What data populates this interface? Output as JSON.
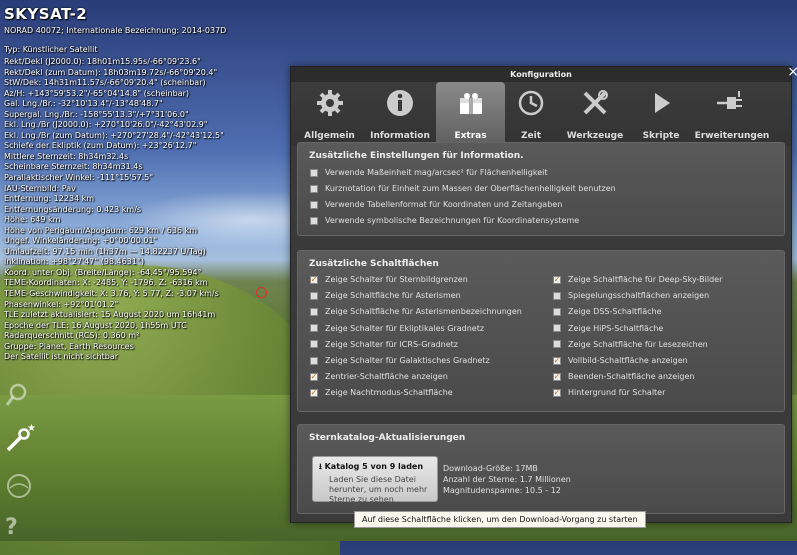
{
  "object": {
    "name": "SKYSAT-2",
    "norad": "NORAD 40072; Internationale Bezeichnung: 2014-037D",
    "type_line": "Typ: Künstlicher Satellit",
    "lines": [
      "Rekt/Dekl (J2000.0): 18h01m15.95s/-66°09'23.6\"",
      "Rekt/Dekl (zum Datum): 18h03m19.72s/-66°09'20.4\"",
      "StW/Dek: 14h31m11.57s/-66°09'20.4\" (scheinbar)",
      "Az/H: +143°59'53.2\"/-65°04'14.8\" (scheinbar)",
      "Gal. Lng./Br.: -32°10'13.4\"/-13°48'48.7\"",
      "Supergal. Lng./Br.: -158°55'13.3\"/+7°31'06.0\"",
      "Ekl. Lng./Br (J2000.0): +270°10'26.0\"/-42°43'02.9\"",
      "Ekl. Lng./Br (zum Datum): +270°27'28.4\"/-42°43'12.5\"",
      "Schiefe der Ekliptik (zum Datum): +23°26'12.7\"",
      "Mittlere Sternzeit: 8h34m32.4s",
      "Scheinbare Sternzeit: 8h34m31.4s",
      "Parallaktischer Winkel: -111°15'57.5\"",
      "IAU-Sternbild: Pav",
      "Entfernung: 12234 km",
      "Entfernungsänderung: 0.423 km/s",
      "Höhe: 649 km",
      "Höhe von Perigäum/Apogäum: 629 km / 636 km",
      "Ungef. Winkeländerung: +0°00'00.01\"",
      "Umlaufzeit: 97.15 min (1h37m — 14.82237 U/Tag)",
      "Inklination: +98°27'47\" (98.4631°)",
      "Koord. unter Obj. (Breite/Länge): -64.45°/95.594°",
      "TEME-Koordinaten: X: -2485, Y: -1796, Z: -6316 km",
      "TEME-Geschwindigkeit: X: 3.76, Y: 5.77, Z: -3.07 km/s",
      "Phasenwinkel: +92°01'01.2\"",
      "TLE zuletzt aktualisiert: 15 August 2020 um 16h41m",
      "Epoche der TLE: 16 August 2020, 1h55m UTC",
      "Radarquerschnitt (RCS): 0.360 m²",
      "Gruppe: Planet, Earth Resources",
      "Der Satellit ist nicht sichtbar"
    ]
  },
  "dialog": {
    "title": "Konfiguration",
    "close": "×",
    "tabs": [
      {
        "label": "Allgemein",
        "icon": "gear-icon"
      },
      {
        "label": "Information",
        "icon": "info-icon"
      },
      {
        "label": "Extras",
        "icon": "extras-icon",
        "active": true
      },
      {
        "label": "Zeit",
        "icon": "clock-icon"
      },
      {
        "label": "Werkzeuge",
        "icon": "tools-icon"
      },
      {
        "label": "Skripte",
        "icon": "play-icon"
      },
      {
        "label": "Erweiterungen",
        "icon": "plugin-icon"
      }
    ],
    "info_group": {
      "title": "Zusätzliche Einstellungen für Information.",
      "options": [
        {
          "label": "Verwende Maßeinheit mag/arcsec² für Flächenhelligkeit",
          "checked": false
        },
        {
          "label": "Kurznotation für Einheit zum Massen der Oberflächenhelligkeit benutzen",
          "checked": false
        },
        {
          "label": "Verwende Tabellenformat für Koordinaten und Zeitangaben",
          "checked": false
        },
        {
          "label": "Verwende symbolische Bezeichnungen für Koordinatensysteme",
          "checked": false
        }
      ]
    },
    "buttons_group": {
      "title": "Zusätzliche Schaltflächen",
      "left": [
        {
          "label": "Zeige Schalter für Sternbildgrenzen",
          "checked": true
        },
        {
          "label": "Zeige Schaltfläche für Asterismen",
          "checked": false
        },
        {
          "label": "Zeige Schaltfläche für Asterismenbezeichnungen",
          "checked": false
        },
        {
          "label": "Zeige Schalter für Ekliptikales Gradnetz",
          "checked": false
        },
        {
          "label": "Zeige Schalter für ICRS-Gradnetz",
          "checked": false
        },
        {
          "label": "Zeige Schalter für Galaktisches Gradnetz",
          "checked": false
        },
        {
          "label": "Zentrier-Schaltfläche anzeigen",
          "checked": true
        },
        {
          "label": "Zeige Nachtmodus-Schaltfläche",
          "checked": true
        }
      ],
      "right": [
        {
          "label": "Zeige Schaltfläche für Deep-Sky-Bilder",
          "checked": true
        },
        {
          "label": "Spiegelungsschaltflächen anzeigen",
          "checked": false
        },
        {
          "label": "Zeige DSS-Schaltfläche",
          "checked": false
        },
        {
          "label": "Zeige HiPS-Schaltfläche",
          "checked": false
        },
        {
          "label": "Zeige Schaltfläche für Lesezeichen",
          "checked": false
        },
        {
          "label": "Vollbild-Schaltfläche anzeigen",
          "checked": true
        },
        {
          "label": "Beenden-Schaltfläche anzeigen",
          "checked": true
        },
        {
          "label": "Hintergrund für Schalter",
          "checked": true
        }
      ]
    },
    "catalog_group": {
      "title": "Sternkatalog-Aktualisierungen",
      "button_title": "Katalog 5 von 9 laden",
      "button_desc": [
        "Laden Sie diese Datei",
        "herunter, um noch mehr",
        "Sterne zu sehen"
      ],
      "stats": [
        "Download-Größe: 17MB",
        "Anzahl der Sterne: 1.7 Millionen",
        "Magnitudenspanne: 10.5 - 12"
      ]
    }
  },
  "tooltip": "Auf diese Schaltfläche klicken, um den Download-Vorgang zu starten",
  "check_mark": "✓",
  "colors": {
    "accent_check": "#c07000",
    "dialog_bg": "#3a3a3a"
  }
}
